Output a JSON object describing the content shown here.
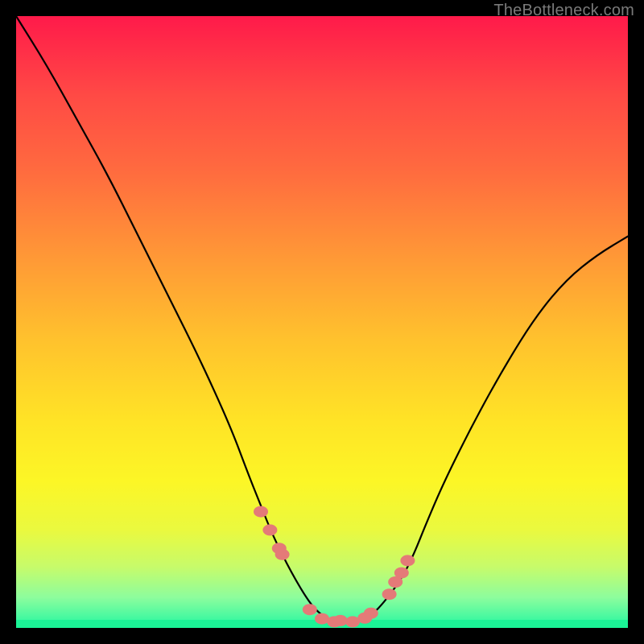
{
  "watermark": "TheBottleneck.com",
  "colors": {
    "frame": "#000000",
    "curve": "#000000",
    "marker": "#e47a78",
    "gradient_top": "#ff1a4a",
    "gradient_bottom": "#22f7a2"
  },
  "chart_data": {
    "type": "line",
    "title": "",
    "xlabel": "",
    "ylabel": "",
    "xlim": [
      0,
      100
    ],
    "ylim": [
      0,
      100
    ],
    "grid": false,
    "legend": false,
    "note": "Axes are unlabeled; x is normalized 0–100 left→right, y is 0 (bottom) to 100 (top). Curve estimated from pixels.",
    "series": [
      {
        "name": "bottleneck-curve",
        "x": [
          0,
          5,
          10,
          15,
          20,
          25,
          30,
          35,
          38,
          40,
          42,
          45,
          48,
          50,
          52,
          55,
          58,
          60,
          63,
          65,
          67,
          70,
          75,
          80,
          85,
          90,
          95,
          100
        ],
        "y": [
          100,
          92,
          83,
          74,
          64,
          54,
          44,
          33,
          25,
          20,
          15,
          9,
          4,
          2,
          1,
          1,
          2,
          4,
          8,
          12,
          17,
          24,
          34,
          43,
          51,
          57,
          61,
          64
        ]
      }
    ],
    "markers": {
      "name": "highlighted-points",
      "x": [
        40,
        41.5,
        43,
        43.5,
        48,
        50,
        52,
        53,
        55,
        57,
        58,
        61,
        62,
        63,
        64
      ],
      "y": [
        19,
        16,
        13,
        12,
        3,
        1.5,
        1,
        1.2,
        1,
        1.6,
        2.4,
        5.5,
        7.5,
        9,
        11
      ]
    }
  }
}
